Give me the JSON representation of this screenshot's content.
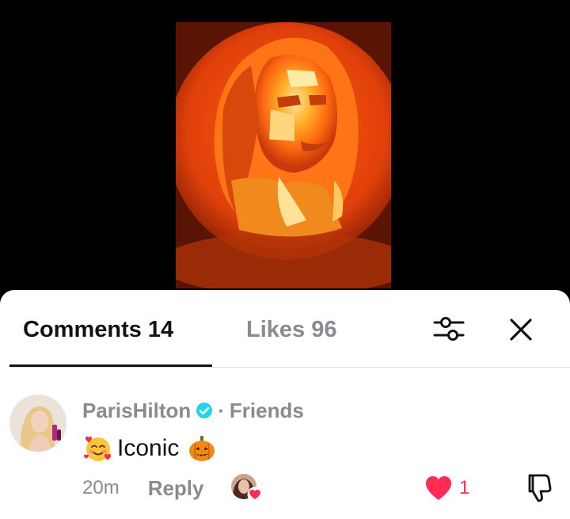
{
  "tabs": {
    "comments_label": "Comments 14",
    "likes_label": "Likes 96"
  },
  "toolbar": {
    "filter_icon": "sliders-icon",
    "close_icon": "close-icon"
  },
  "comment": {
    "author": "ParisHilton",
    "verified": true,
    "separator": "·",
    "relation": "Friends",
    "text": "Iconic",
    "leading_emoji": "smiling-face-with-hearts-icon",
    "trailing_emoji": "jack-o-lantern-icon",
    "timestamp": "20m",
    "reply_label": "Reply",
    "like_count": "1"
  },
  "colors": {
    "like_red": "#fe2c55",
    "verified_blue": "#20d5ec",
    "muted_text": "#8a8a8f",
    "primary_text": "#121212"
  }
}
